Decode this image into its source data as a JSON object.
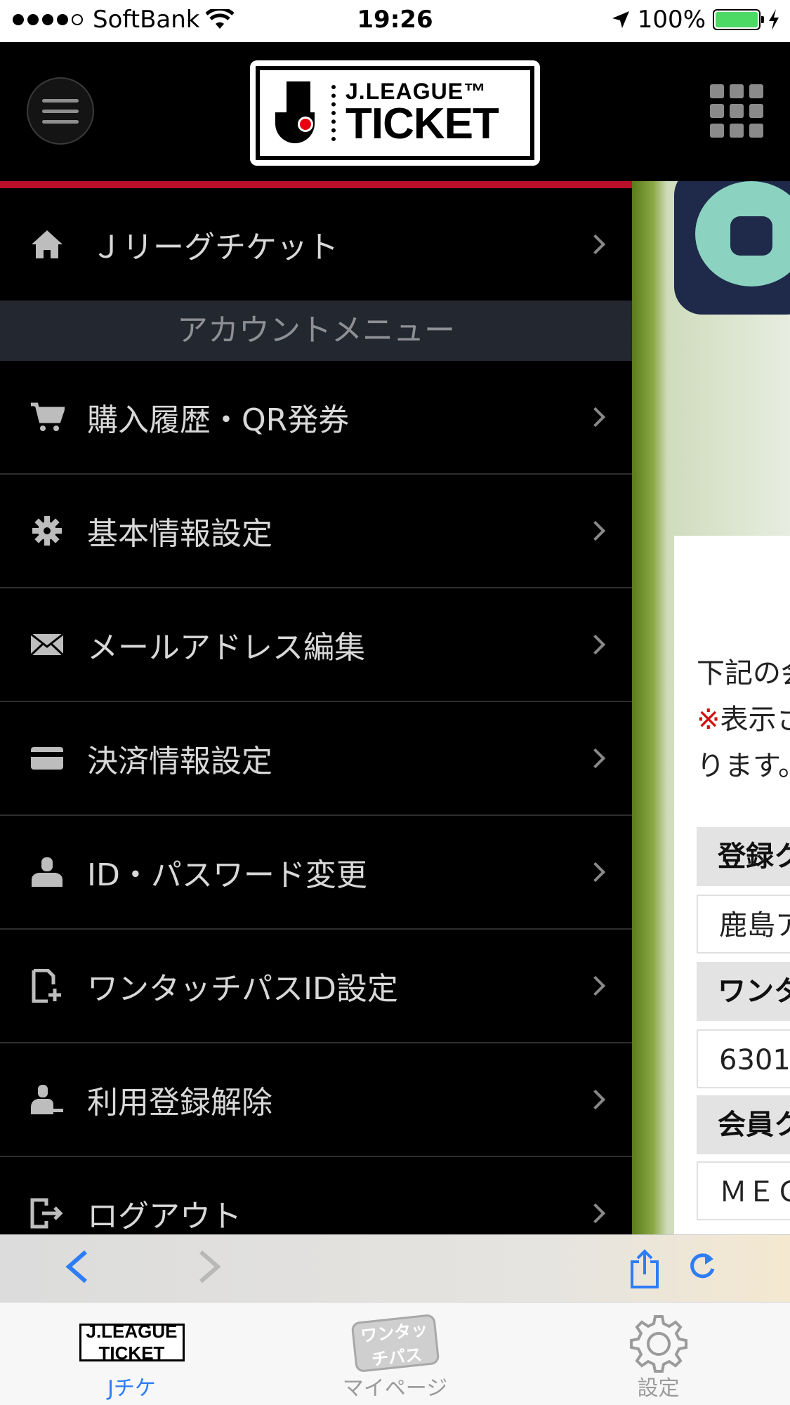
{
  "status_bar": {
    "carrier": "SoftBank",
    "time": "19:26",
    "battery": "100%"
  },
  "header": {
    "logo_line1": "J.LEAGUE™",
    "logo_line2": "TICKET"
  },
  "drawer": {
    "home_item": "Ｊリーグチケット",
    "section_title": "アカウントメニュー",
    "items": [
      {
        "label": "購入履歴・QR発券",
        "icon": "cart-icon"
      },
      {
        "label": "基本情報設定",
        "icon": "gear-icon"
      },
      {
        "label": "メールアドレス編集",
        "icon": "envelope-icon"
      },
      {
        "label": "決済情報設定",
        "icon": "credit-card-icon"
      },
      {
        "label": "ID・パスワード変更",
        "icon": "user-icon"
      },
      {
        "label": "ワンタッチパスID設定",
        "icon": "file-add-icon"
      },
      {
        "label": "利用登録解除",
        "icon": "user-remove-icon"
      },
      {
        "label": "ログアウト",
        "icon": "logout-icon"
      }
    ]
  },
  "peek": {
    "line1": "下記の会",
    "line2_mark": "※",
    "line2": "表示さ",
    "line3": "ります。",
    "rows": [
      {
        "type": "h",
        "text": "登録ク"
      },
      {
        "type": "v",
        "text": "鹿島ア"
      },
      {
        "type": "h",
        "text": "ワンタ"
      },
      {
        "type": "v",
        "text": "6301"
      },
      {
        "type": "h",
        "text": "会員ク"
      },
      {
        "type": "v",
        "text": "ＭＥＣ"
      }
    ]
  },
  "toolbar": {
    "back": "<",
    "forward": ">"
  },
  "tabbar": {
    "tabs": [
      {
        "label": "Jチケ",
        "icon_text": "J.LEAGUE TICKET",
        "active": true
      },
      {
        "label": "マイページ",
        "icon_text": "ワンタッチパス",
        "active": false
      },
      {
        "label": "設定",
        "active": false
      }
    ]
  },
  "colors": {
    "accent_red": "#b8102a",
    "ios_blue": "#2e7cf6",
    "section_bg": "#222730"
  }
}
